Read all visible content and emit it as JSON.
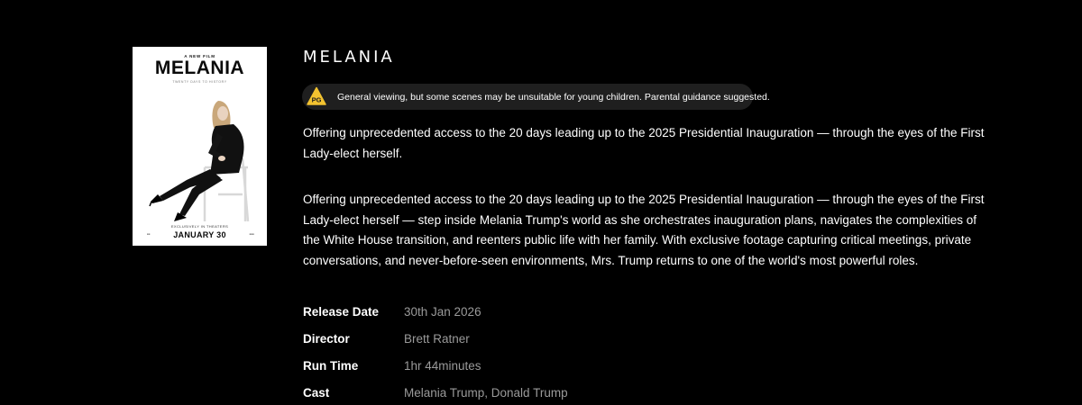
{
  "poster": {
    "tagline": "A NEW FILM",
    "title": "MELANIA",
    "subtitle": "TWENTY DAYS TO HISTORY",
    "exclusive": "EXCLUSIVELY IN THEATERS",
    "date": "JANUARY 30"
  },
  "movie": {
    "title": "MELANIA",
    "rating_text": "General viewing, but some scenes may be unsuitable for young children. Parental guidance suggested.",
    "rating_icon": "pg-warning-icon",
    "synopsis_short": "Offering unprecedented access to the 20 days leading up to the 2025 Presidential Inauguration — through the eyes of the First Lady-elect herself.",
    "synopsis_long": "Offering unprecedented access to the 20 days leading up to the 2025 Presidential Inauguration — through the eyes of the First Lady-elect herself — step inside Melania Trump's world as she orchestrates inauguration plans, navigates the complexities of the White House transition, and reenters public life with her family. With exclusive footage capturing critical meetings, private conversations, and never-before-seen environments, Mrs. Trump returns to one of the world's most powerful roles."
  },
  "details": [
    {
      "label": "Release Date",
      "value": "30th Jan 2026"
    },
    {
      "label": "Director",
      "value": "Brett Ratner"
    },
    {
      "label": "Run Time",
      "value": "1hr 44minutes"
    },
    {
      "label": "Cast",
      "value": "Melania Trump, Donald Trump"
    }
  ],
  "colors": {
    "background": "#000000",
    "badge_background": "#1f1f1f",
    "warning_yellow": "#f2c230",
    "detail_value": "#9a9a9a"
  }
}
